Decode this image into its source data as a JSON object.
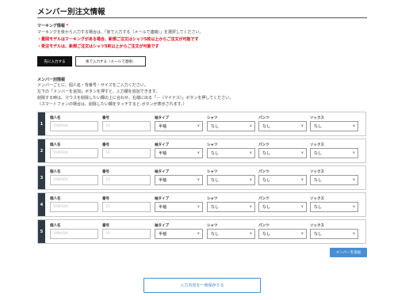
{
  "page": {
    "title": "メンバー別注文情報"
  },
  "marking": {
    "heading": "マーキング情報",
    "required_mark": "*",
    "desc": "マーキングを後から入力する場合は、「後で入力する（メールで連絡）」を選択してください。",
    "warn1": "・豊岡モデルはマーキングがある場合、新規ご注文はシャツ5枚以上からご注文が可能です",
    "warn2": "・受注モデルは、新規ご注文はシャツ5枚以上からご注文が可能です",
    "btn_now": "先に入力する",
    "btn_later": "後で入力する（メールで連絡）"
  },
  "member_info": {
    "heading": "メンバー別情報",
    "lines": [
      "メンバーごとに、個人名・背番号・サイズをご入力ください。",
      "左下の「メンバーを追加」ボタンを押すと、入力欄を追加できます。",
      "削除する時は、マウスを削除したい欄の上に合わせ、右端に出る「－（マイナス）」ボタンを押してください。",
      "（スマートフォンの場合は、削除したい欄をタッチすると-ボタンが表示されます。）"
    ]
  },
  "labels": {
    "name": "個人名",
    "number": "番号",
    "neck": "袖タイプ",
    "shirt": "シャツ",
    "pants": "パンツ",
    "socks": "ソックス"
  },
  "placeholders": {
    "name": "YAMADA",
    "number": "10"
  },
  "members": [
    {
      "num": "1",
      "neck": "半袖",
      "shirt": "なし",
      "pants": "なし",
      "socks": "なし"
    },
    {
      "num": "2",
      "neck": "半袖",
      "shirt": "なし",
      "pants": "なし",
      "socks": "なし"
    },
    {
      "num": "3",
      "neck": "半袖",
      "shirt": "なし",
      "pants": "なし",
      "socks": "なし"
    },
    {
      "num": "4",
      "neck": "半袖",
      "shirt": "なし",
      "pants": "なし",
      "socks": "なし"
    },
    {
      "num": "5",
      "neck": "半袖",
      "shirt": "なし",
      "pants": "なし",
      "socks": "なし"
    }
  ],
  "actions": {
    "add_member": "メンバーを追加",
    "save": "入力内容を一時保存する"
  },
  "colors": {
    "accent": "#4a8fd3",
    "row_number_bg": "#2e3b47",
    "warning": "#e60012"
  }
}
